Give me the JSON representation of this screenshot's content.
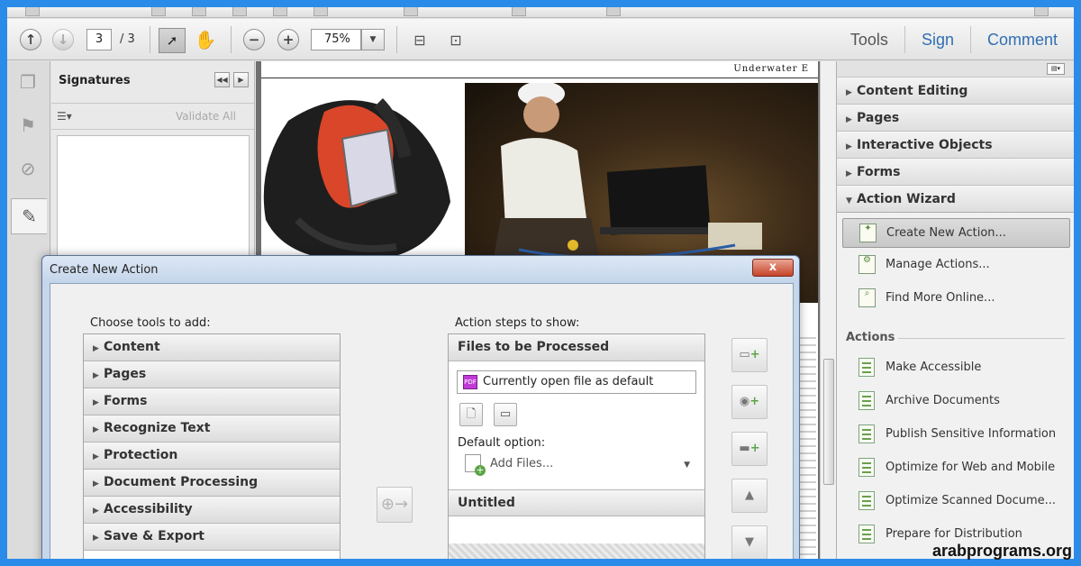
{
  "toolbar": {
    "page_current": "3",
    "page_total": "/ 3",
    "zoom": "75%",
    "links": [
      "Tools",
      "Sign",
      "Comment"
    ]
  },
  "signatures": {
    "title": "Signatures",
    "validate_all": "Validate All"
  },
  "document": {
    "header_text": "Underwater E"
  },
  "right_panel": {
    "sections": [
      "Content Editing",
      "Pages",
      "Interactive Objects",
      "Forms"
    ],
    "open_section": "Action Wizard",
    "wizard_items": [
      "Create New Action...",
      "Manage Actions...",
      "Find More Online..."
    ],
    "actions_heading": "Actions",
    "actions": [
      "Make Accessible",
      "Archive Documents",
      "Publish Sensitive Information",
      "Optimize for Web and Mobile",
      "Optimize Scanned Docume...",
      "Prepare for Distribution"
    ]
  },
  "dialog": {
    "title": "Create New Action",
    "close_label": "x",
    "choose_label": "Choose tools to add:",
    "tools": [
      "Content",
      "Pages",
      "Forms",
      "Recognize Text",
      "Protection",
      "Document Processing",
      "Accessibility",
      "Save & Export"
    ],
    "steps_label": "Action steps to show:",
    "files_heading": "Files to be Processed",
    "file_value": "Currently open file as default",
    "default_option_label": "Default option:",
    "add_files": "Add Files...",
    "untitled": "Untitled"
  },
  "watermark": "arabprograms.org",
  "colors": {
    "frame": "#2b8be8",
    "link_blue": "#2f6fb3",
    "close_red": "#c6442a"
  }
}
